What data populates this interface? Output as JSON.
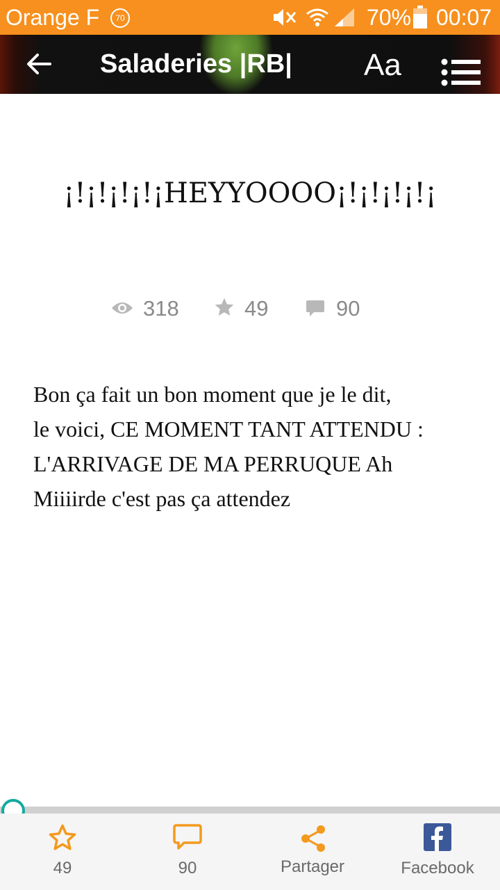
{
  "status_bar": {
    "carrier": "Orange F",
    "notification_badge": "70",
    "battery_percent": "70%",
    "time": "00:07",
    "icons": [
      "mute-icon",
      "wifi-icon",
      "signal-icon",
      "battery-icon"
    ]
  },
  "header": {
    "title": "Saladeries |RB|",
    "font_button": "Aa",
    "icons": [
      "back-arrow-icon",
      "list-menu-icon"
    ]
  },
  "post": {
    "title": "¡!¡!¡!¡!¡HEYYOOOO¡!¡!¡!¡!¡",
    "stats": {
      "views": "318",
      "likes": "49",
      "comments": "90"
    },
    "body_lines": [
      "Bon ça fait un bon moment que je le dit,",
      "le voici, CE MOMENT TANT ATTENDU :",
      "L'ARRIVAGE DE MA PERRUQUE Ah",
      "Miiiirde c'est pas ça attendez"
    ]
  },
  "reading_progress": 0.0,
  "bottom_bar": {
    "like_count": "49",
    "comment_count": "90",
    "share_label": "Partager",
    "facebook_label": "Facebook"
  },
  "colors": {
    "status_bar": "#f7901e",
    "accent_orange": "#f39a1e",
    "progress_teal": "#14a9a1",
    "facebook_blue": "#3b5998"
  }
}
